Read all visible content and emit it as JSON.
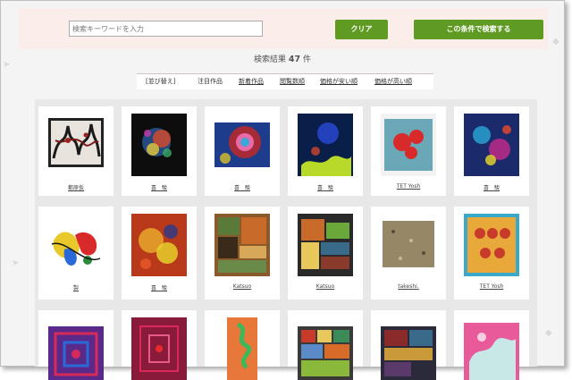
{
  "search": {
    "placeholder": "検索キーワードを入力",
    "clear_label": "クリア",
    "submit_label": "この条件で検索する"
  },
  "results": {
    "prefix": "検索結果",
    "count": "47",
    "suffix": "件"
  },
  "sort": {
    "label": "[並び替え]",
    "options": [
      "注目作品",
      "新着作品",
      "閲覧数順",
      "価格が安い順",
      "価格が高い順"
    ]
  },
  "artworks": [
    {
      "label": "都原仮"
    },
    {
      "label": "喜　駿"
    },
    {
      "label": "喜　駿"
    },
    {
      "label": "喜　駿"
    },
    {
      "label": "TET Yosh"
    },
    {
      "label": "喜　駿"
    },
    {
      "label": "製"
    },
    {
      "label": "喜　駿"
    },
    {
      "label": "Katsuo"
    },
    {
      "label": "Katsuo"
    },
    {
      "label": "takeshi."
    },
    {
      "label": "TET Yosh"
    },
    {
      "label": ""
    },
    {
      "label": ""
    },
    {
      "label": ""
    },
    {
      "label": ""
    },
    {
      "label": ""
    },
    {
      "label": ""
    }
  ]
}
